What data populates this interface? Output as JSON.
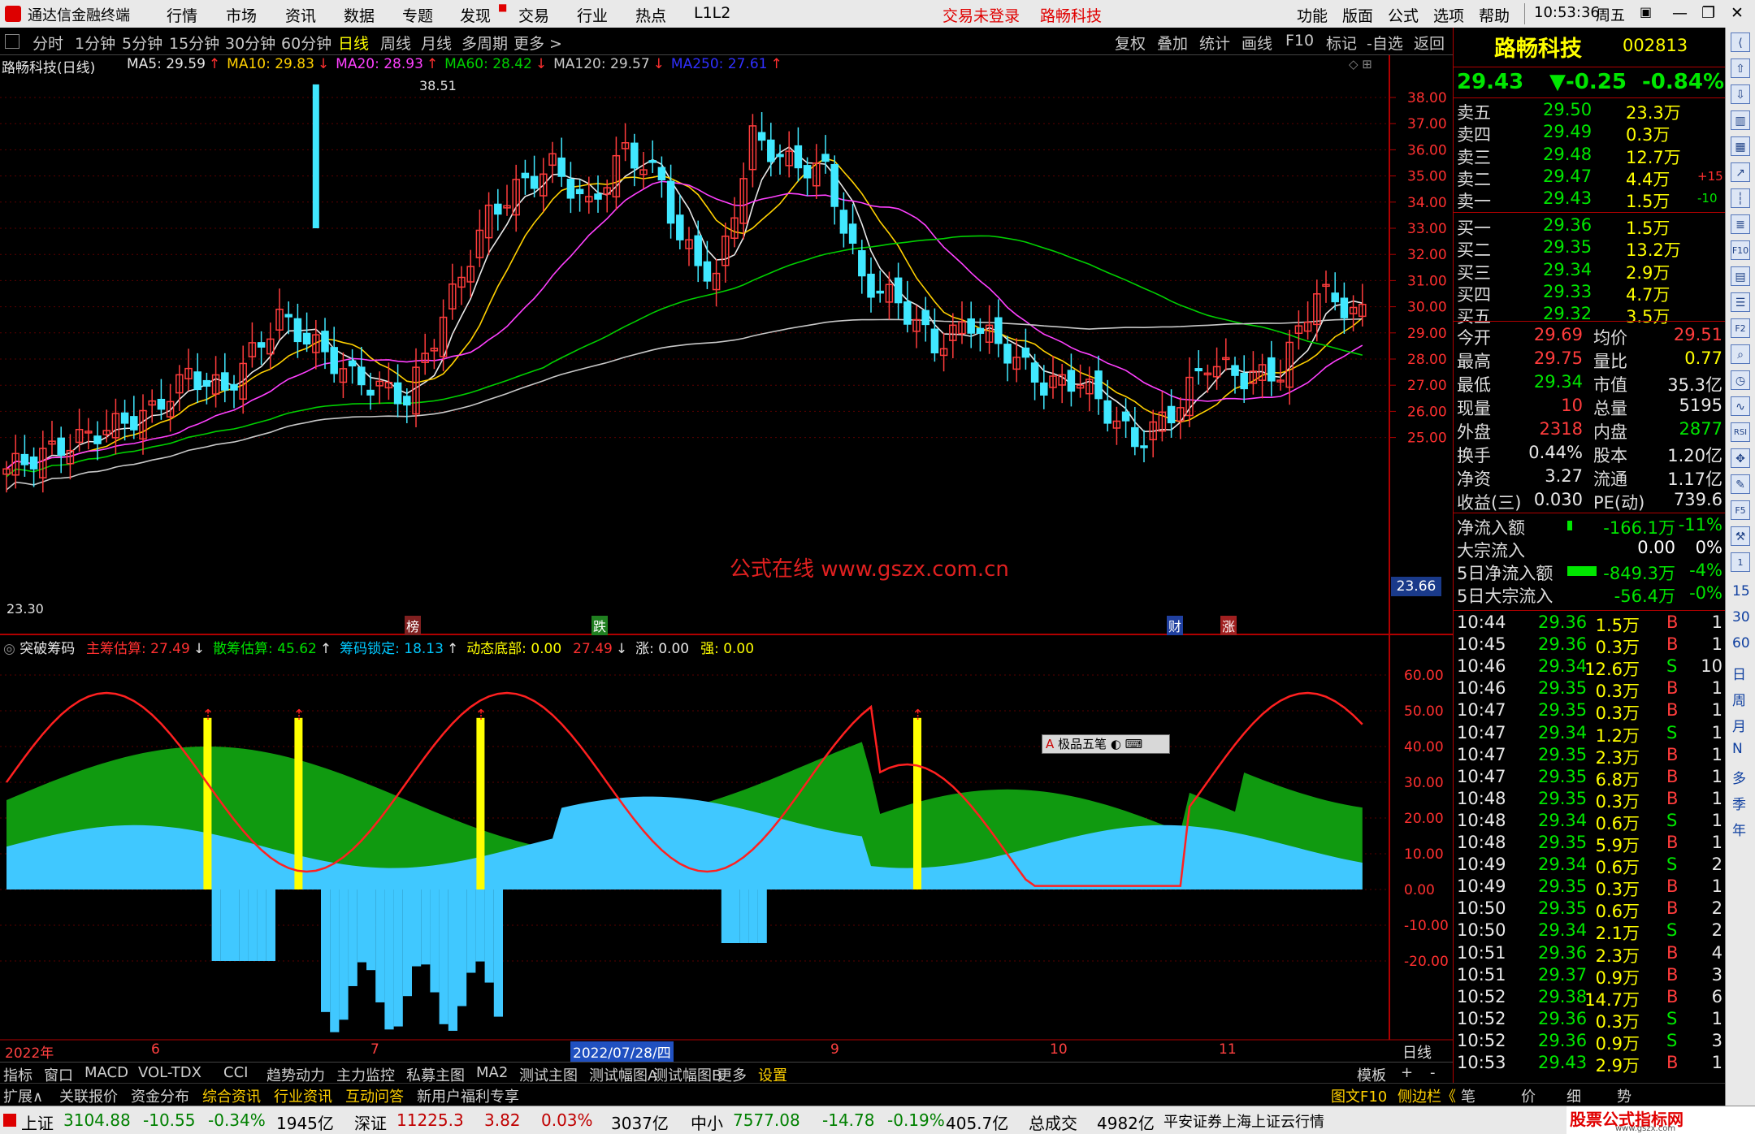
{
  "menubar": {
    "app_title": "通达信金融终端",
    "menus": [
      "行情",
      "市场",
      "资讯",
      "数据",
      "专题",
      "发现",
      "交易",
      "行业",
      "热点",
      "L1L2"
    ],
    "login_status": "交易未登录",
    "stock_name": "路畅科技",
    "right_menus": [
      "功能",
      "版面",
      "公式",
      "选项",
      "帮助"
    ],
    "clock": "10:53:36",
    "weekday": "周五"
  },
  "periodbar": {
    "periods": [
      "分时",
      "1分钟",
      "5分钟",
      "15分钟",
      "30分钟",
      "60分钟",
      "日线",
      "周线",
      "月线",
      "多周期",
      "更多 >"
    ],
    "selected": "日线",
    "tools": [
      "复权",
      "叠加",
      "统计",
      "画线",
      "F10",
      "标记",
      "-自选",
      "返回"
    ]
  },
  "main_chart": {
    "title": "路畅科技(日线)",
    "ma": [
      {
        "label": "MA5: 29.59",
        "arrow": "↑",
        "color": "#e8e8e8"
      },
      {
        "label": "MA10: 29.83",
        "arrow": "↓",
        "color": "#ffd000"
      },
      {
        "label": "MA20: 28.93",
        "arrow": "↑",
        "color": "#ff40ff"
      },
      {
        "label": "MA60: 28.42",
        "arrow": "↓",
        "color": "#00d000"
      },
      {
        "label": "MA120: 29.57",
        "arrow": "↓",
        "color": "#c8c8c8"
      },
      {
        "label": "MA250: 27.61",
        "arrow": "↑",
        "color": "#3030ff"
      }
    ],
    "price_axis": [
      "38.00",
      "37.00",
      "36.00",
      "35.00",
      "34.00",
      "33.00",
      "32.00",
      "31.00",
      "30.00",
      "29.00",
      "28.00",
      "27.00",
      "26.00",
      "25.00"
    ],
    "current_price_tag": "23.66",
    "high_label": "38.51",
    "low_label": "23.30",
    "watermark": "公式在线  www.gszx.com.cn",
    "markers": [
      "榜",
      "跌",
      "财",
      "涨"
    ]
  },
  "indicator": {
    "name": "突破筹码",
    "items": [
      {
        "label": "主筹估算: 27.49",
        "arrow": "↓",
        "color": "#ff3030"
      },
      {
        "label": "散筹估算: 45.62",
        "arrow": "↑",
        "color": "#00e000"
      },
      {
        "label": "筹码锁定: 18.13",
        "arrow": "↑",
        "color": "#00c8ff"
      },
      {
        "label": "动态底部: 0.00",
        "arrow": "",
        "color": "#ffff00"
      },
      {
        "label": "27.49",
        "arrow": "↓",
        "color": "#ff3030"
      },
      {
        "label": "涨: 0.00",
        "arrow": "",
        "color": "#e8e8e8"
      },
      {
        "label": "强: 0.00",
        "arrow": "",
        "color": "#ffff00"
      }
    ],
    "axis": [
      "60.00",
      "50.00",
      "40.00",
      "30.00",
      "20.00",
      "10.00",
      "0.00",
      "-10.00",
      "-20.00"
    ],
    "popup": "极品五笔"
  },
  "time_axis": {
    "labels": [
      "2022年",
      "6",
      "7",
      "2022/07/28/四",
      "9",
      "10",
      "11"
    ],
    "period_label": "日线"
  },
  "quote": {
    "name": "路畅科技",
    "code": "002813",
    "price": "29.43",
    "change": "▼-0.25",
    "pct": "-0.84%",
    "asks": [
      {
        "label": "卖五",
        "price": "29.50",
        "vol": "23.3万",
        "delta": ""
      },
      {
        "label": "卖四",
        "price": "29.49",
        "vol": "0.3万",
        "delta": ""
      },
      {
        "label": "卖三",
        "price": "29.48",
        "vol": "12.7万",
        "delta": ""
      },
      {
        "label": "卖二",
        "price": "29.47",
        "vol": "4.4万",
        "delta": "+15"
      },
      {
        "label": "卖一",
        "price": "29.43",
        "vol": "1.5万",
        "delta": "-10"
      }
    ],
    "bids": [
      {
        "label": "买一",
        "price": "29.36",
        "vol": "1.5万"
      },
      {
        "label": "买二",
        "price": "29.35",
        "vol": "13.2万"
      },
      {
        "label": "买三",
        "price": "29.34",
        "vol": "2.9万"
      },
      {
        "label": "买四",
        "price": "29.33",
        "vol": "4.7万"
      },
      {
        "label": "买五",
        "price": "29.32",
        "vol": "3.5万"
      }
    ],
    "stats": [
      {
        "k1": "今开",
        "v1": "29.69",
        "k2": "均价",
        "v2": "29.51",
        "c1": "red",
        "c2": "red"
      },
      {
        "k1": "最高",
        "v1": "29.75",
        "k2": "量比",
        "v2": "0.77",
        "c1": "red",
        "c2": "yel"
      },
      {
        "k1": "最低",
        "v1": "29.34",
        "k2": "市值",
        "v2": "35.3亿",
        "c1": "green",
        "c2": "wht"
      },
      {
        "k1": "现量",
        "v1": "10",
        "k2": "总量",
        "v2": "5195",
        "c1": "red",
        "c2": "wht"
      },
      {
        "k1": "外盘",
        "v1": "2318",
        "k2": "内盘",
        "v2": "2877",
        "c1": "red",
        "c2": "green"
      },
      {
        "k1": "换手",
        "v1": "0.44%",
        "k2": "股本",
        "v2": "1.20亿",
        "c1": "wht",
        "c2": "wht"
      },
      {
        "k1": "净资",
        "v1": "3.27",
        "k2": "流通",
        "v2": "1.17亿",
        "c1": "wht",
        "c2": "wht"
      },
      {
        "k1": "收益(三)",
        "v1": "0.030",
        "k2": "PE(动)",
        "v2": "739.6",
        "c1": "wht",
        "c2": "wht"
      }
    ],
    "flows": [
      {
        "k": "净流入额",
        "v": "-166.1万",
        "p": "-11%"
      },
      {
        "k": "大宗流入",
        "v": "0.00",
        "p": "0%"
      },
      {
        "k": "5日净流入额",
        "v": "-849.3万",
        "p": "-4%"
      },
      {
        "k": "5日大宗流入",
        "v": "-56.4万",
        "p": "-0%"
      }
    ],
    "ticks": [
      {
        "t": "10:44",
        "p": "29.36",
        "v": "1.5万",
        "s": "B",
        "n": "1"
      },
      {
        "t": "10:45",
        "p": "29.36",
        "v": "0.3万",
        "s": "B",
        "n": "1"
      },
      {
        "t": "10:46",
        "p": "29.34",
        "v": "12.6万",
        "s": "S",
        "n": "10"
      },
      {
        "t": "10:46",
        "p": "29.35",
        "v": "0.3万",
        "s": "B",
        "n": "1"
      },
      {
        "t": "10:47",
        "p": "29.35",
        "v": "0.3万",
        "s": "B",
        "n": "1"
      },
      {
        "t": "10:47",
        "p": "29.34",
        "v": "1.2万",
        "s": "S",
        "n": "1"
      },
      {
        "t": "10:47",
        "p": "29.35",
        "v": "2.3万",
        "s": "B",
        "n": "1"
      },
      {
        "t": "10:47",
        "p": "29.35",
        "v": "6.8万",
        "s": "B",
        "n": "1"
      },
      {
        "t": "10:48",
        "p": "29.35",
        "v": "0.3万",
        "s": "B",
        "n": "1"
      },
      {
        "t": "10:48",
        "p": "29.34",
        "v": "0.6万",
        "s": "S",
        "n": "1"
      },
      {
        "t": "10:48",
        "p": "29.35",
        "v": "5.9万",
        "s": "B",
        "n": "1"
      },
      {
        "t": "10:49",
        "p": "29.34",
        "v": "0.6万",
        "s": "S",
        "n": "2"
      },
      {
        "t": "10:49",
        "p": "29.35",
        "v": "0.3万",
        "s": "B",
        "n": "1"
      },
      {
        "t": "10:50",
        "p": "29.35",
        "v": "0.6万",
        "s": "B",
        "n": "2"
      },
      {
        "t": "10:50",
        "p": "29.34",
        "v": "2.1万",
        "s": "S",
        "n": "2"
      },
      {
        "t": "10:51",
        "p": "29.36",
        "v": "2.3万",
        "s": "B",
        "n": "4"
      },
      {
        "t": "10:51",
        "p": "29.37",
        "v": "0.9万",
        "s": "B",
        "n": "3"
      },
      {
        "t": "10:52",
        "p": "29.38",
        "v": "14.7万",
        "s": "B",
        "n": "6"
      },
      {
        "t": "10:52",
        "p": "29.36",
        "v": "0.3万",
        "s": "S",
        "n": "1"
      },
      {
        "t": "10:52",
        "p": "29.36",
        "v": "0.9万",
        "s": "S",
        "n": "3"
      },
      {
        "t": "10:53",
        "p": "29.43",
        "v": "2.9万",
        "s": "B",
        "n": "1"
      }
    ],
    "bottom_tabs": [
      "笔",
      "价",
      "细",
      "势"
    ]
  },
  "side_icons": [
    "日",
    "周",
    "月",
    "N",
    "多",
    "季",
    "年"
  ],
  "side_nums": [
    "15",
    "30",
    "60"
  ],
  "indicator_tabs": [
    "指标",
    "窗口",
    "MACD",
    "VOL-TDX",
    "CCI",
    "趋势动力",
    "主力监控",
    "私募主图",
    "MA2",
    "测试主图",
    "测试幅图A",
    "测试幅图B",
    "更多",
    "设置"
  ],
  "indicator_tab_right": [
    "模板",
    "+",
    "-"
  ],
  "bottom_tabs": [
    "扩展∧",
    "关联报价",
    "资金分布",
    "综合资讯",
    "行业资讯",
    "互动问答",
    "新用户福利专享"
  ],
  "bottom_tabs_right": [
    "图文F10",
    "侧边栏《"
  ],
  "status": {
    "sh_name": "上证",
    "sh_val": "3104.88",
    "sh_chg": "-10.55",
    "sh_pct": "-0.34%",
    "sh_amt": "1945亿",
    "sz_name": "深证",
    "sz_val": "11225.3",
    "sz_chg": "3.82",
    "sz_pct": "0.03%",
    "sz_amt": "3037亿",
    "zx_name": "中小",
    "zx_val": "7577.08",
    "zx_chg": "-14.78",
    "zx_pct": "-0.19%",
    "zx_amt": "405.7亿",
    "total_label": "总成交",
    "total_amt": "4982亿",
    "broker": "平安证券上海上证云行情",
    "brand": "股票公式指标网",
    "brand_url": "www.gszx.com"
  }
}
